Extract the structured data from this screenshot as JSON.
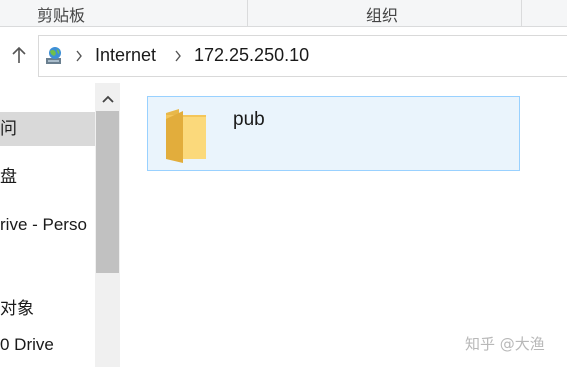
{
  "ribbon": {
    "groups": [
      "剪贴板",
      "组织"
    ]
  },
  "address_bar": {
    "icon": "network-globe-icon",
    "breadcrumbs": [
      "Internet",
      "172.25.250.10"
    ]
  },
  "nav_pane": {
    "items": [
      {
        "label": "问",
        "selected": true
      },
      {
        "label": "盘",
        "selected": false
      },
      {
        "label": "rive - Perso",
        "selected": false
      },
      {
        "label": "对象",
        "selected": false
      },
      {
        "label": "0 Drive",
        "selected": false
      }
    ]
  },
  "content": {
    "items": [
      {
        "name": "pub",
        "type": "folder"
      }
    ]
  },
  "watermark": "知乎 @大渔"
}
